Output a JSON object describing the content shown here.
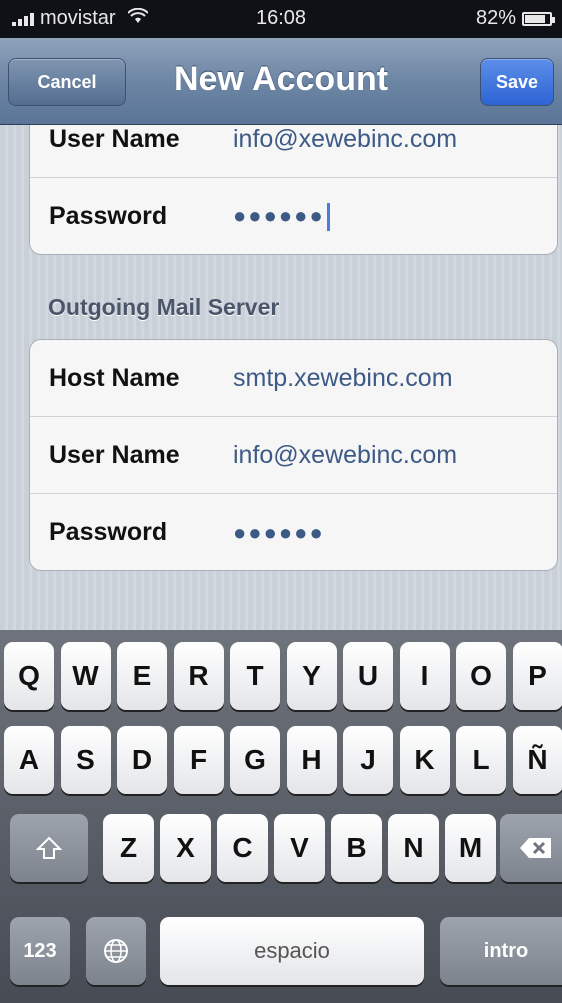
{
  "status_bar": {
    "carrier": "movistar",
    "time": "16:08",
    "battery": "82%",
    "battery_level": 0.82
  },
  "nav": {
    "cancel_label": "Cancel",
    "title": "New Account",
    "save_label": "Save"
  },
  "incoming": {
    "username_label": "User Name",
    "username_value": "info@xewebinc.com",
    "password_label": "Password",
    "password_value": "●●●●●●"
  },
  "outgoing": {
    "header": "Outgoing Mail Server",
    "hostname_label": "Host Name",
    "hostname_value": "smtp.xewebinc.com",
    "username_label": "User Name",
    "username_value": "info@xewebinc.com",
    "password_label": "Password",
    "password_value": "●●●●●●"
  },
  "keyboard": {
    "row1": [
      "Q",
      "W",
      "E",
      "R",
      "T",
      "Y",
      "U",
      "I",
      "O",
      "P"
    ],
    "row2": [
      "A",
      "S",
      "D",
      "F",
      "G",
      "H",
      "J",
      "K",
      "L",
      "Ñ"
    ],
    "row3": [
      "Z",
      "X",
      "C",
      "V",
      "B",
      "N",
      "M"
    ],
    "numbers_label": "123",
    "space_label": "espacio",
    "return_label": "intro",
    "shift_icon": "shift-icon",
    "delete_icon": "delete-icon",
    "globe_icon": "globe-icon"
  },
  "colors": {
    "nav_bar": "#6d86a5",
    "save_button": "#2e64d4",
    "value_text": "#3d5a87",
    "keyboard_bg": "#464b54"
  }
}
